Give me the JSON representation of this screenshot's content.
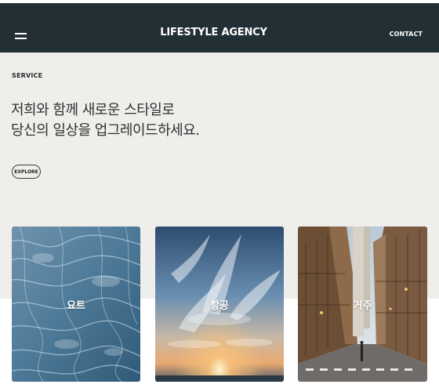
{
  "header": {
    "brand": "LIFESTYLE AGENCY",
    "contact_label": "CONTACT"
  },
  "hero": {
    "eyebrow": "SERVICE",
    "headline_line1": "저희와 함께 새로운 스타일로",
    "headline_line2": "당신의 일상을 업그레이드하세요.",
    "cta_label": "EXPLORE"
  },
  "services": [
    {
      "label": "요트",
      "image": "water-surface"
    },
    {
      "label": "항공",
      "image": "sunset-sky"
    },
    {
      "label": "거주",
      "image": "city-street"
    }
  ],
  "colors": {
    "header_bg": "#223035",
    "hero_bg": "#f0eeea",
    "text_dark": "#2e3234"
  }
}
